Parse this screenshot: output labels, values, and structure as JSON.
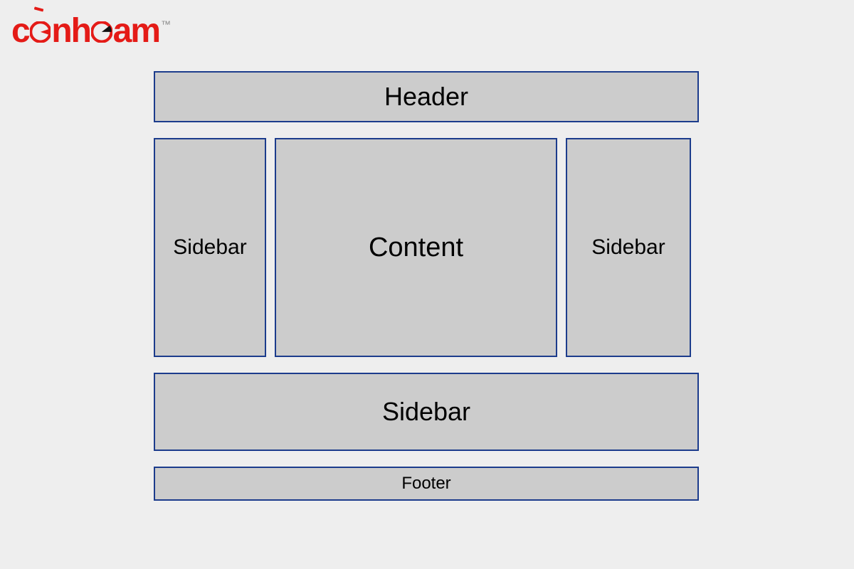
{
  "brand": {
    "name_part1": "c",
    "name_part2": "nh",
    "name_part3": "am",
    "tm": "™"
  },
  "layout": {
    "header": "Header",
    "sidebar_left": "Sidebar",
    "content": "Content",
    "sidebar_right": "Sidebar",
    "sidebar_bottom": "Sidebar",
    "footer": "Footer"
  },
  "colors": {
    "page_bg": "#eeeeee",
    "region_fill": "#cccccc",
    "region_border": "#1c3c8c",
    "brand_red": "#e41b17"
  }
}
